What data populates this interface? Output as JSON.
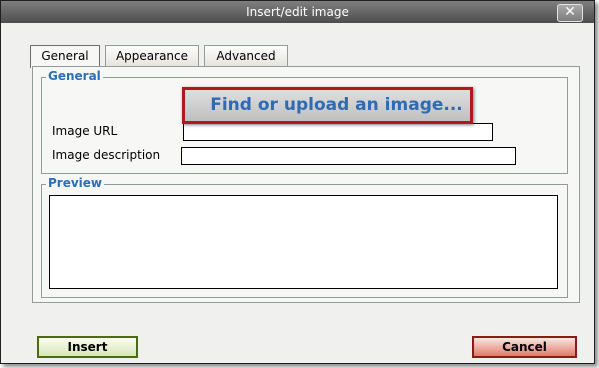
{
  "dialog": {
    "title": "Insert/edit image",
    "close_label": "✕"
  },
  "tabs": [
    {
      "label": "General",
      "active": true
    },
    {
      "label": "Appearance",
      "active": false
    },
    {
      "label": "Advanced",
      "active": false
    }
  ],
  "general": {
    "legend": "General",
    "find_upload_label": "Find or upload an image...",
    "image_url_label": "Image URL",
    "image_url_value": "",
    "image_description_label": "Image description",
    "image_description_value": ""
  },
  "preview": {
    "legend": "Preview"
  },
  "buttons": {
    "insert_label": "Insert",
    "cancel_label": "Cancel"
  },
  "colors": {
    "legend": "#2b6fb6",
    "highlight_border": "#b3171c",
    "insert_border": "#4b6b12",
    "cancel_border": "#8a1b16"
  }
}
